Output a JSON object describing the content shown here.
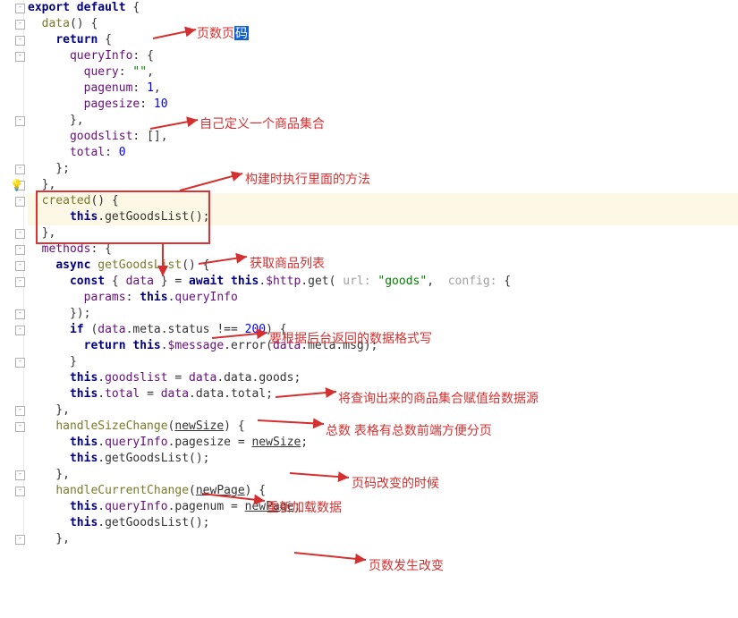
{
  "code": {
    "l1": "export default {",
    "l2": "  data() {",
    "l3": "    return {",
    "l4": "      queryInfo: {",
    "l5a": "        query: ",
    "l5b": "\"\"",
    "l5c": ",",
    "l6a": "        pagenum: ",
    "l6b": "1",
    "l6c": ",",
    "l7a": "        pagesize: ",
    "l7b": "10",
    "l8": "      },",
    "l9": "      goodslist: [],",
    "l10a": "      total: ",
    "l10b": "0",
    "l11": "    };",
    "l12": "  },",
    "l13": "  created() {",
    "l14": "      this.getGoodsList();",
    "l15": "  },",
    "l16": "  methods: {",
    "l17": "    async getGoodsList() {",
    "l18a": "      const { ",
    "l18b": "data",
    "l18c": " } = await this.$http.get(",
    "l18d": " url: ",
    "l18e": "\"goods\"",
    "l18f": ",  ",
    "l18g": "config: ",
    "l18h": "{",
    "l19": "        params: this.queryInfo",
    "l20": "      });",
    "l21a": "      if (",
    "l21b": "data",
    "l21c": ".meta.status !== ",
    "l21d": "200",
    "l21e": ") {",
    "l22a": "        return this.$message.error(",
    "l22b": "data",
    "l22c": ".meta.msg);",
    "l23": "      }",
    "l24a": "      this.goodslist = ",
    "l24b": "data",
    "l24c": ".data.goods;",
    "l25a": "      this.total = ",
    "l25b": "data",
    "l25c": ".data.total;",
    "l26": "    },",
    "l27a": "    handleSizeChange(",
    "l27b": "newSize",
    "l27c": ") {",
    "l28a": "      this.queryInfo.pagesize = ",
    "l28b": "newSize",
    "l28c": ";",
    "l29": "      this.getGoodsList();",
    "l30": "    },",
    "l31a": "    handleCurrentChange(",
    "l31b": "newPage",
    "l31c": ") {",
    "l32a": "      this.queryInfo.pagenum = ",
    "l32b": "newPage",
    "l32c": ";",
    "l33": "      this.getGoodsList();",
    "l34": "    },"
  },
  "annotations": {
    "a1a": "页数页",
    "a1b": "码",
    "a2": "自己定义一个商品集合",
    "a3": "构建时执行里面的方法",
    "a4": "获取商品列表",
    "a5": "要根据后台返回的数据格式写",
    "a6": "将查询出来的商品集合赋值给数据源",
    "a7": "总数 表格有总数前端方便分页",
    "a8": "页码改变的时候",
    "a9": "重新加载数据",
    "a10": "页数发生改变"
  }
}
